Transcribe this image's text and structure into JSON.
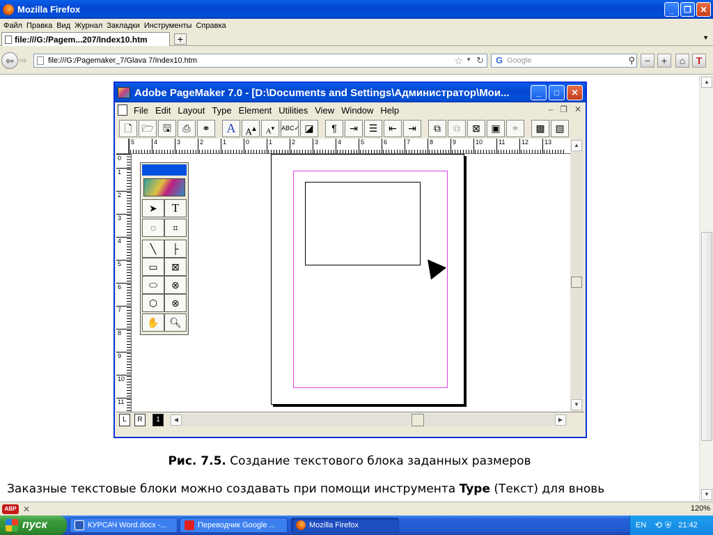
{
  "browser": {
    "title": "Mozilla Firefox",
    "menu": [
      "Файл",
      "Правка",
      "Вид",
      "Журнал",
      "Закладки",
      "Инструменты",
      "Справка"
    ],
    "tab_label": "file:///G:/Pagem...207/Index10.htm",
    "url": "file:///G:/Pagemaker_7/Glava 7/Index10.htm",
    "search_placeholder": "Google"
  },
  "pagemaker": {
    "title": "Adobe PageMaker 7.0 - [D:\\Documents and Settings\\Администратор\\Мои...",
    "menu": [
      "File",
      "Edit",
      "Layout",
      "Type",
      "Element",
      "Utilities",
      "View",
      "Window",
      "Help"
    ],
    "h_ruler": [
      "5",
      "4",
      "3",
      "2",
      "1",
      "0",
      "1",
      "2",
      "3",
      "4",
      "5",
      "6",
      "7",
      "8",
      "9",
      "10",
      "11",
      "12",
      "13",
      "1"
    ],
    "v_ruler": [
      "0",
      "1",
      "2",
      "3",
      "4",
      "5",
      "6",
      "7",
      "8",
      "9",
      "10",
      "11"
    ],
    "master_left": "L",
    "master_right": "R",
    "page_number": "1"
  },
  "content": {
    "caption_bold": "Рис. 7.5.",
    "caption_text": " Создание текстового блока заданных размеров",
    "body_pre": "Заказные текстовые блоки можно создавать при помощи инструмента ",
    "body_bold": "Type",
    "body_post": " (Текст) для вновь"
  },
  "status": {
    "adblock": "ABP",
    "zoom": "120%"
  },
  "taskbar": {
    "start": "пуск",
    "tasks": [
      "КУРСАЧ Word.docx -...",
      "Переводчик Google ...",
      "Mozilla Firefox"
    ],
    "lang": "EN",
    "time": "21:42"
  },
  "colors": {
    "xp_blue": "#0446d0",
    "margin_guide": "#e040e0",
    "start_green": "#3a9a3a"
  }
}
